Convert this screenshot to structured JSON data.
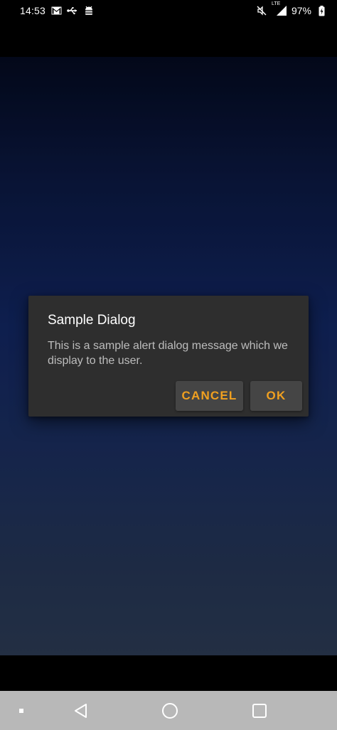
{
  "status_bar": {
    "time": "14:53",
    "battery_percent": "97%",
    "network_label": "LTE",
    "left_icons": [
      "gmail-icon",
      "usb-icon",
      "android-debug-icon"
    ],
    "right_icons": [
      "mute-icon",
      "signal-icon",
      "battery-charging-icon"
    ]
  },
  "dialog": {
    "title": "Sample Dialog",
    "message": "This is a sample alert dialog message which we display to the user.",
    "cancel_label": "CANCEL",
    "ok_label": "OK"
  },
  "nav_bar": {
    "items": [
      "dot-icon",
      "back-icon",
      "home-icon",
      "recents-icon"
    ]
  },
  "colors": {
    "accent": "#f0a020",
    "dialog_background": "#2e2e2e",
    "button_background": "#454545",
    "nav_bar_background": "#b8b8b8"
  }
}
